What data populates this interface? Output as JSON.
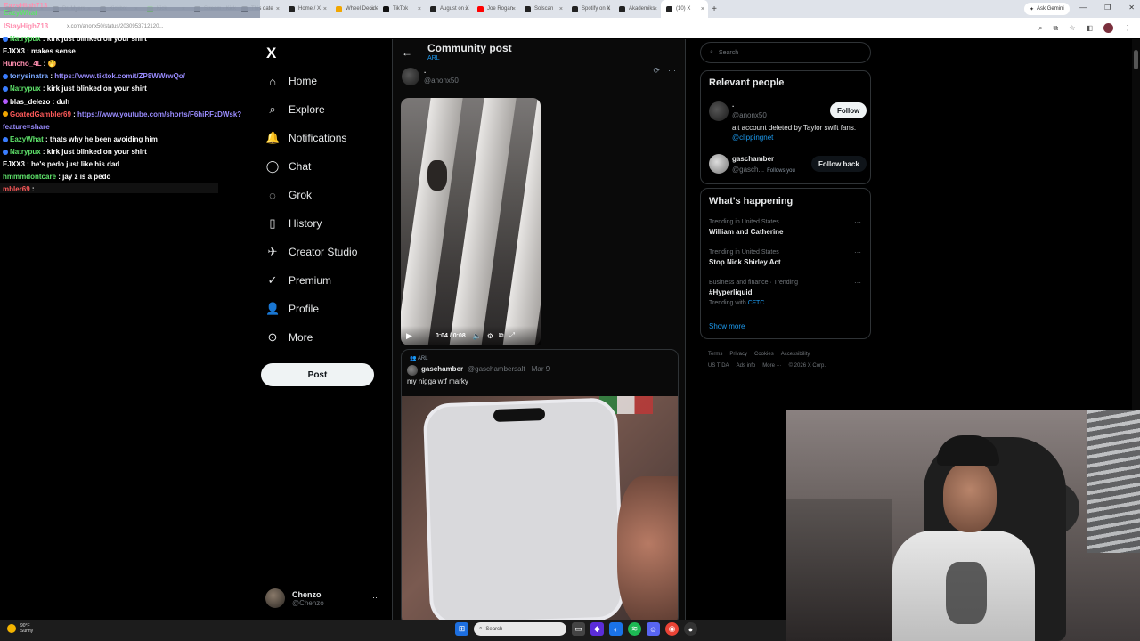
{
  "browser": {
    "tabs": [
      {
        "label": "Stream",
        "color": "#7a7a7a"
      },
      {
        "label": "Dr. Myers",
        "color": "#222222"
      },
      {
        "label": "Kickbot",
        "color": "#222222"
      },
      {
        "label": "Kick",
        "color": "#53fc18"
      },
      {
        "label": "Stream - Kick",
        "color": "#222222"
      },
      {
        "label": "This date",
        "color": "#111111"
      },
      {
        "label": "Home / X",
        "color": "#222222"
      },
      {
        "label": "Wheel Decide",
        "color": "#f1a600"
      },
      {
        "label": "TikTok",
        "color": "#111111"
      },
      {
        "label": "August on X",
        "color": "#222222"
      },
      {
        "label": "Joe Rogan",
        "color": "#ff0000"
      },
      {
        "label": "Solscan",
        "color": "#222222"
      },
      {
        "label": "Spotify on X",
        "color": "#222222"
      },
      {
        "label": "Akademiks",
        "color": "#222222"
      },
      {
        "label": "(10) X",
        "color": "#222222",
        "active": true
      }
    ],
    "new_tab": "+",
    "ask_gemini": "Ask Gemini",
    "url": "x.com/anonx50/status/2030953712120...",
    "window_controls": [
      "—",
      "❐",
      "✕"
    ],
    "toolbar_icons": [
      "⌕",
      "⧉",
      "☆",
      "◧",
      "⋮"
    ]
  },
  "chat": {
    "top_users": [
      {
        "name": "EazyHigh713",
        "color": "#ff8fb0"
      },
      {
        "name": "EazyWhat",
        "color": "#5ee26a"
      },
      {
        "name": "IStayHigh713",
        "color": "#ff8fb0"
      }
    ],
    "messages": [
      {
        "user": "Natrypux",
        "ucls": "u-green",
        "text": "kirk just blinked on your shirt",
        "badge": "#3a7dff"
      },
      {
        "user": "EJXX3",
        "ucls": "u-white",
        "text": "makes sense",
        "badge": ""
      },
      {
        "user": "Huncho_4L",
        "ucls": "u-pink",
        "text": "🤭",
        "badge": ""
      },
      {
        "user": "tonysinatra",
        "ucls": "u-blue",
        "text": "https://www.tiktok.com/t/ZP8WWrwQo/",
        "link": true,
        "badge": "#3a7dff"
      },
      {
        "user": "Natrypux",
        "ucls": "u-green",
        "text": "kirk just blinked on your shirt",
        "badge": "#3a7dff"
      },
      {
        "user": "blas_delezo",
        "ucls": "u-white",
        "text": "duh",
        "badge": "#b35aff"
      },
      {
        "user": "GoatedGambler69",
        "ucls": "u-red",
        "text": "https://www.youtube.com/shorts/F6hiRFzDWsk?",
        "link": true,
        "badge": "#f1a600"
      },
      {
        "user": "",
        "ucls": "u-white",
        "text": "feature=share",
        "link": true,
        "badge": ""
      },
      {
        "user": "EazyWhat",
        "ucls": "u-green",
        "text": "thats why he been avoiding him",
        "badge": "#3a7dff"
      },
      {
        "user": "Natrypux",
        "ucls": "u-green",
        "text": "kirk just blinked on your shirt",
        "badge": "#3a7dff"
      },
      {
        "user": "EJXX3",
        "ucls": "u-white",
        "text": "he's pedo just like his dad",
        "badge": ""
      },
      {
        "user": "hmmmdontcare",
        "ucls": "u-green",
        "text": "jay z is a pedo",
        "badge": ""
      },
      {
        "user": "mbler69",
        "ucls": "u-red",
        "text": "",
        "badge": ""
      }
    ]
  },
  "sidebar": {
    "logo": "X",
    "items": [
      {
        "label": "Home",
        "icon": "⌂",
        "name": "home"
      },
      {
        "label": "Explore",
        "icon": "⌕",
        "name": "explore"
      },
      {
        "label": "Notifications",
        "icon": "🔔",
        "name": "notifications"
      },
      {
        "label": "Chat",
        "icon": "◯",
        "name": "chat"
      },
      {
        "label": "Grok",
        "icon": "◌",
        "name": "grok"
      },
      {
        "label": "History",
        "icon": "▯",
        "name": "history"
      },
      {
        "label": "Creator Studio",
        "icon": "✈",
        "name": "creator-studio"
      },
      {
        "label": "Premium",
        "icon": "✓",
        "name": "premium"
      },
      {
        "label": "Profile",
        "icon": "👤",
        "name": "profile"
      },
      {
        "label": "More",
        "icon": "⊙",
        "name": "more"
      }
    ],
    "post_label": "Post",
    "account": {
      "name": "Chenzo",
      "handle": "@Chenzo",
      "more": "···"
    }
  },
  "main": {
    "back": "←",
    "title": "Community post",
    "subtitle": "ARL",
    "post": {
      "name": ".",
      "handle": "@anonx50"
    },
    "actions": [
      "⟳",
      "···"
    ],
    "video": {
      "time": "0:04 / 0:08",
      "progress": 0.5
    },
    "quote": {
      "community": "ARL",
      "name": "gaschamber",
      "handle": "@gaschambersalt · Mar 9",
      "text": "my nigga wtf marky"
    }
  },
  "right": {
    "search_placeholder": "Search",
    "relevant_title": "Relevant people",
    "people": [
      {
        "name": ".",
        "handle": "@anonx50",
        "bio": "alt account deleted by Taylor swift fans.",
        "bio_link": "@clippingnet",
        "button": "Follow"
      },
      {
        "name": "gaschamber",
        "handle": "@gasch...",
        "follows_you": "Follows you",
        "button": "Follow back"
      }
    ],
    "happening_title": "What's happening",
    "trends": [
      {
        "meta": "Trending in United States",
        "name": "William and Catherine"
      },
      {
        "meta": "Trending in United States",
        "name": "Stop Nick Shirley Act"
      },
      {
        "meta": "Business and finance · Trending",
        "name": "#Hyperliquid",
        "with_label": "Trending with",
        "with_link": "CFTC"
      }
    ],
    "show_more": "Show more",
    "footer": [
      "Terms",
      "Privacy",
      "Cookies",
      "Accessibility",
      "US TIDA",
      "Ads info",
      "More ···",
      "© 2026 X Corp."
    ]
  },
  "taskbar": {
    "weather_temp": "90°F",
    "weather_desc": "Sunny",
    "search_label": "Search"
  }
}
